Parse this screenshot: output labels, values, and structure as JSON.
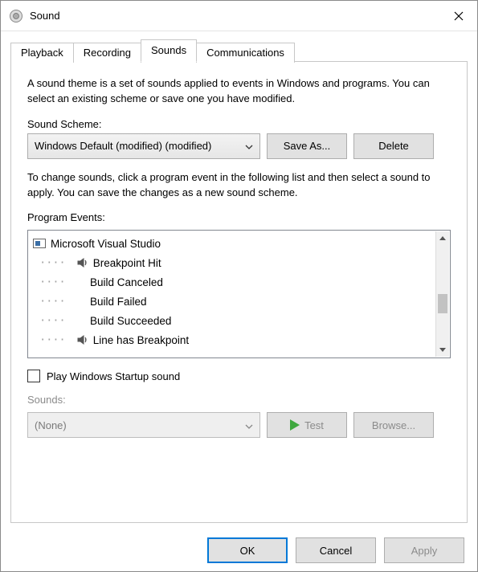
{
  "window": {
    "title": "Sound"
  },
  "tabs": [
    {
      "label": "Playback",
      "active": false
    },
    {
      "label": "Recording",
      "active": false
    },
    {
      "label": "Sounds",
      "active": true
    },
    {
      "label": "Communications",
      "active": false
    }
  ],
  "body": {
    "theme_desc": "A sound theme is a set of sounds applied to events in Windows and programs.  You can select an existing scheme or save one you have modified.",
    "scheme_label": "Sound Scheme:",
    "scheme_value": "Windows Default (modified) (modified)",
    "save_as": "Save As...",
    "delete": "Delete",
    "change_desc": "To change sounds, click a program event in the following list and then select a sound to apply.  You can save the changes as a new sound scheme.",
    "events_label": "Program Events:",
    "events": {
      "group": "Microsoft Visual Studio",
      "items": [
        {
          "label": "Breakpoint Hit",
          "has_sound": true
        },
        {
          "label": "Build Canceled",
          "has_sound": false
        },
        {
          "label": "Build Failed",
          "has_sound": false
        },
        {
          "label": "Build Succeeded",
          "has_sound": false
        },
        {
          "label": "Line has Breakpoint",
          "has_sound": true
        }
      ]
    },
    "startup_checkbox": "Play Windows Startup sound",
    "sounds_label": "Sounds:",
    "sound_value": "(None)",
    "test": "Test",
    "browse": "Browse..."
  },
  "footer": {
    "ok": "OK",
    "cancel": "Cancel",
    "apply": "Apply"
  },
  "colors": {
    "accent": "#0078d7",
    "play_icon": "#3fa83f"
  }
}
